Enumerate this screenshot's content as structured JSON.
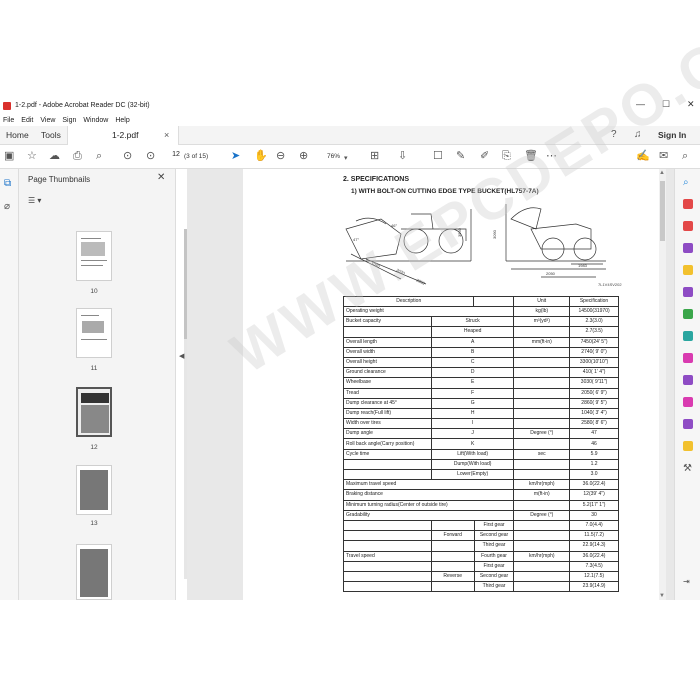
{
  "window": {
    "title": "1-2.pdf - Adobe Acrobat Reader DC (32-bit)",
    "minimize": "—",
    "maximize": "☐",
    "close": "✕"
  },
  "menu": [
    "File",
    "Edit",
    "View",
    "Sign",
    "Window",
    "Help"
  ],
  "tabs": {
    "home": "Home",
    "tools": "Tools",
    "doc": "1-2.pdf",
    "sign_in": "Sign In"
  },
  "toolbar": {
    "page_value": "12",
    "page_of": "(3 of 15)",
    "zoom": "76%"
  },
  "thumbnails": {
    "title": "Page Thumbnails",
    "pages": [
      "10",
      "11",
      "12",
      "13"
    ],
    "selected": "12"
  },
  "document": {
    "heading": "2. SPECIFICATIONS",
    "subheading": "1) WITH BOLT-ON CUTTING EDGE TYPE BUCKET(HL757-7A)",
    "figure_code": "7L1V4SV202",
    "dims": {
      "d1": "3550",
      "d2": "3090",
      "d3": "1983",
      "w1": "3030",
      "w2": "1040",
      "w3": "2860",
      "w4": "47°",
      "w5": "46°",
      "w6": "2050"
    },
    "watermark": "WWW.EPCDEPO.COM",
    "table": {
      "headers": [
        "Description",
        "Unit",
        "Specification"
      ],
      "rows": [
        [
          "Operating weight",
          "",
          "kg(lb)",
          "14500(31970)"
        ],
        [
          "Bucket capacity",
          "Struck",
          "m³(yd³)",
          "2.3(3.0)"
        ],
        [
          "",
          "Heaped",
          "",
          "2.7(3.5)"
        ],
        [
          "Overall length",
          "A",
          "mm(ft-in)",
          "7450(24' 5\")"
        ],
        [
          "Overall width",
          "B",
          "",
          "2740( 9' 0\")"
        ],
        [
          "Overall height",
          "C",
          "",
          "3300(10'10\")"
        ],
        [
          "Ground clearance",
          "D",
          "",
          "410(  1' 4\")"
        ],
        [
          "Wheelbase",
          "E",
          "",
          "3030( 9'11\")"
        ],
        [
          "Tread",
          "F",
          "",
          "2050( 6' 9\")"
        ],
        [
          "Dump clearance at 45°",
          "G",
          "",
          "2860( 9' 5\")"
        ],
        [
          "Dump reach(Full lift)",
          "H",
          "",
          "1040( 3' 4\")"
        ],
        [
          "Width over tires",
          "I",
          "",
          "2580( 8' 6\")"
        ],
        [
          "Dump angle",
          "J",
          "Degree (°)",
          "47"
        ],
        [
          "Roll back angle(Carry position)",
          "K",
          "",
          "46"
        ],
        [
          "Cycle time",
          "Lift(With load)",
          "sec",
          "5.9"
        ],
        [
          "",
          "Dump(With load)",
          "",
          "1.2"
        ],
        [
          "",
          "Lower(Empty)",
          "",
          "3.0"
        ],
        [
          "Maximum travel speed",
          "",
          "km/hr(mph)",
          "36.0(22.4)"
        ],
        [
          "Braking distance",
          "",
          "m(ft-in)",
          "12(39' 4\")"
        ],
        [
          "Minimum turning radius(Center of outside tire)",
          "",
          "",
          "5.2(17' 1\")"
        ],
        [
          "Gradability",
          "",
          "Degree (°)",
          "30"
        ]
      ],
      "travel": {
        "label": "Travel speed",
        "unit": "km/hr(mph)",
        "forward": "Forward",
        "reverse": "Reverse",
        "rows": [
          [
            "First gear",
            "7.0(4.4)"
          ],
          [
            "Second gear",
            "11.5(7.2)"
          ],
          [
            "Third gear",
            "22.9(14.3)"
          ],
          [
            "Fourth gear",
            "36.0(22.4)"
          ],
          [
            "First gear",
            "7.3(4.5)"
          ],
          [
            "Second gear",
            "12.1(7.5)"
          ],
          [
            "Third gear",
            "23.9(14.9)"
          ]
        ]
      }
    }
  }
}
